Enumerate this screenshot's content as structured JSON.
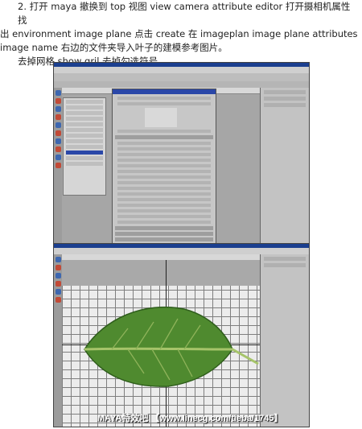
{
  "instructions": {
    "line1": "2. 打开 maya 撤换到 top 视图 view camera attribute editor 打开摄相机属性 找",
    "line2": "出 environment image plane 点击 create 在 imageplan image plane attributes",
    "line3": "image name 右边的文件夹导入叶子的建模参考图片。",
    "line4": "去掉网格 show gril 去掉勾选符号。"
  },
  "watermark": "MAYA特效吧 【www.linecg.com/tieba/1745】"
}
